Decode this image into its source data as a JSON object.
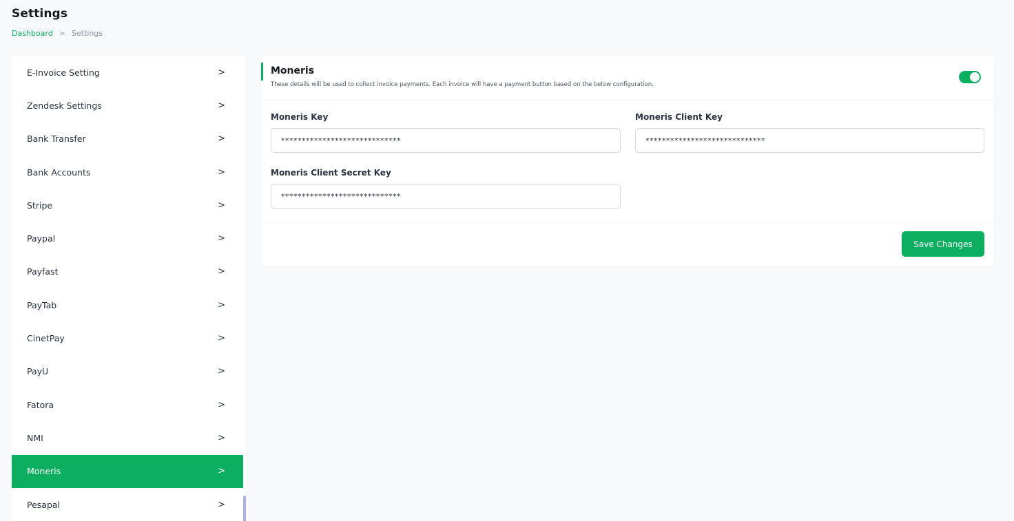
{
  "header": {
    "title": "Settings",
    "breadcrumb": {
      "home": "Dashboard",
      "separator": ">",
      "current": "Settings"
    }
  },
  "sidebar": {
    "items": [
      {
        "label": "E-Invoice Setting"
      },
      {
        "label": "Zendesk Settings"
      },
      {
        "label": "Bank Transfer"
      },
      {
        "label": "Bank Accounts"
      },
      {
        "label": "Stripe"
      },
      {
        "label": "Paypal"
      },
      {
        "label": "Payfast"
      },
      {
        "label": "PayTab"
      },
      {
        "label": "CinetPay"
      },
      {
        "label": "PayU"
      },
      {
        "label": "Fatora"
      },
      {
        "label": "NMI"
      },
      {
        "label": "Moneris",
        "active": true
      },
      {
        "label": "Pesapal"
      }
    ],
    "chevron": ">"
  },
  "card": {
    "title": "Moneris",
    "description": "These details will be used to collect invoice payments. Each invoice will have a payment button based on the below configuration.",
    "enabled": true,
    "fields": {
      "key_label": "Moneris Key",
      "key_value": "*****************************",
      "client_key_label": "Moneris Client Key",
      "client_key_value": "*****************************",
      "secret_label": "Moneris Client Secret Key",
      "secret_value": "*****************************"
    },
    "save_label": "Save Changes"
  },
  "colors": {
    "accent": "#0caf60",
    "background": "#f8f9fa"
  }
}
